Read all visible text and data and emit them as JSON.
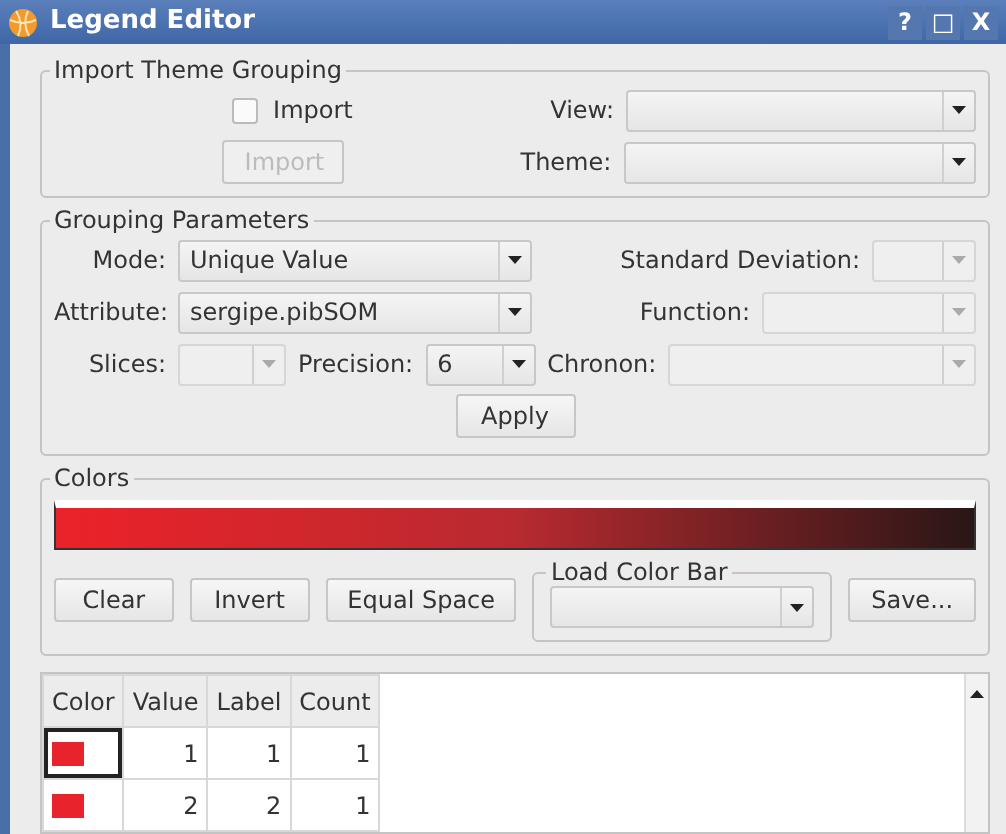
{
  "window": {
    "title": "Legend Editor",
    "controls": [
      "?",
      "□",
      "X"
    ]
  },
  "import_group": {
    "title": "Import Theme Grouping",
    "import_checkbox": {
      "label": "Import",
      "checked": false
    },
    "import_button": {
      "label": "Import",
      "disabled": true
    },
    "view": {
      "label": "View:",
      "disabled": false
    },
    "theme": {
      "label": "Theme:",
      "disabled": false
    }
  },
  "grouping": {
    "title": "Grouping Parameters",
    "mode": {
      "label": "Mode:",
      "value": "Unique Value",
      "disabled": false
    },
    "standard_deviation": {
      "label": "Standard Deviation:",
      "disabled": true
    },
    "attribute": {
      "label": "Attribute:",
      "value": "sergipe.pibSOM",
      "disabled": false
    },
    "function": {
      "label": "Function:",
      "disabled": true
    },
    "slices": {
      "label": "Slices:",
      "disabled": true
    },
    "precision": {
      "label": "Precision:",
      "value": "6",
      "disabled": false
    },
    "chronon": {
      "label": "Chronon:",
      "disabled": true
    },
    "apply_button": "Apply"
  },
  "colors": {
    "title": "Colors",
    "color_bar": [
      {
        "color": "#ec2229"
      },
      {
        "color": "#b82a30"
      },
      {
        "color": "#2a1616"
      }
    ],
    "buttons": [
      "Clear",
      "Invert",
      "Equal Space"
    ],
    "load_color_bar": {
      "title": "Load Color Bar",
      "disabled": false
    },
    "save_button": "Save..."
  },
  "table": {
    "columns": [
      "Color",
      "Value",
      "Label",
      "Count"
    ],
    "rows": [
      {
        "color": "#e8232b",
        "value": "1",
        "label": "1",
        "count": "1",
        "selected": true
      },
      {
        "color": "#e8232b",
        "value": "2",
        "label": "2",
        "count": "1",
        "selected": false
      }
    ]
  }
}
